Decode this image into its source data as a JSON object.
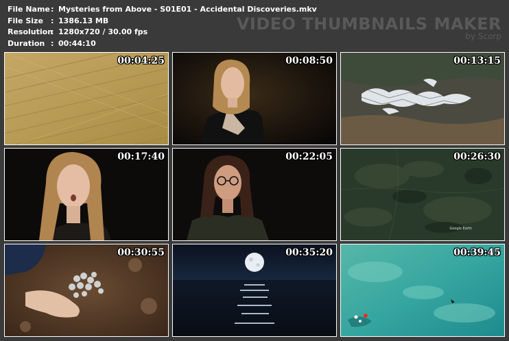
{
  "info": {
    "file_name_label": "File Name",
    "file_name": "Mysteries from Above - S01E01 - Accidental Discoveries.mkv",
    "file_size_label": "File Size",
    "file_size": "1386.13 MB",
    "resolution_label": "Resolution",
    "resolution": "1280x720 / 30.00 fps",
    "duration_label": "Duration",
    "duration": "00:44:10"
  },
  "brand": {
    "title": "VIDEO THUMBNAILS MAKER",
    "subtitle": "by Scorp"
  },
  "thumbnails": [
    {
      "timestamp": "00:04:25",
      "scene": "aerial-wheat-field"
    },
    {
      "timestamp": "00:08:50",
      "scene": "woman-blonde-interview"
    },
    {
      "timestamp": "00:13:15",
      "scene": "satellite-snowy-mountains"
    },
    {
      "timestamp": "00:17:40",
      "scene": "woman-surprised-closeup"
    },
    {
      "timestamp": "00:22:05",
      "scene": "woman-glasses-interview"
    },
    {
      "timestamp": "00:26:30",
      "scene": "satellite-green-land",
      "watermark": "Google Earth"
    },
    {
      "timestamp": "00:30:55",
      "scene": "hand-digging-coins"
    },
    {
      "timestamp": "00:35:20",
      "scene": "moon-over-ocean"
    },
    {
      "timestamp": "00:39:45",
      "scene": "aerial-turquoise-sea"
    }
  ]
}
